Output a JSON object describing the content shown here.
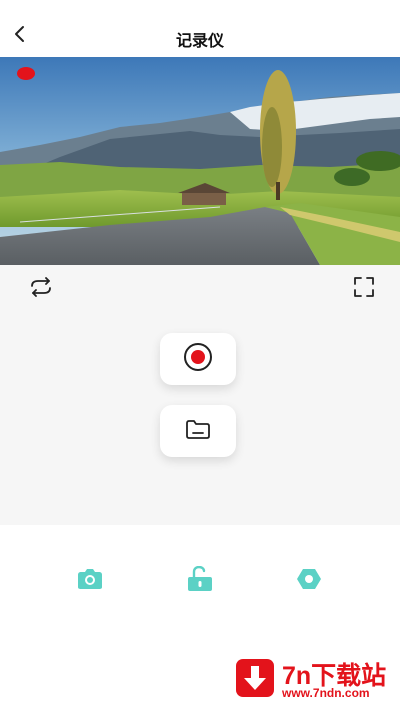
{
  "header": {
    "title": "记录仪",
    "back_icon": "chevron-left-icon"
  },
  "feed": {
    "recording_indicator_color": "#e3131b",
    "scene": "mountain-valley-road"
  },
  "controls": {
    "switch_camera_icon": "rotate-switch-icon",
    "fullscreen_icon": "fullscreen-icon",
    "record_icon": "record-icon",
    "folder_icon": "folder-icon"
  },
  "bottom_nav": {
    "accent_color": "#5bd1c5",
    "items": [
      "camera-icon",
      "unlock-icon",
      "hexagon-icon"
    ]
  },
  "watermark": {
    "name": "7n下载站",
    "url": "www.7ndn.com",
    "color": "#e3131b"
  }
}
